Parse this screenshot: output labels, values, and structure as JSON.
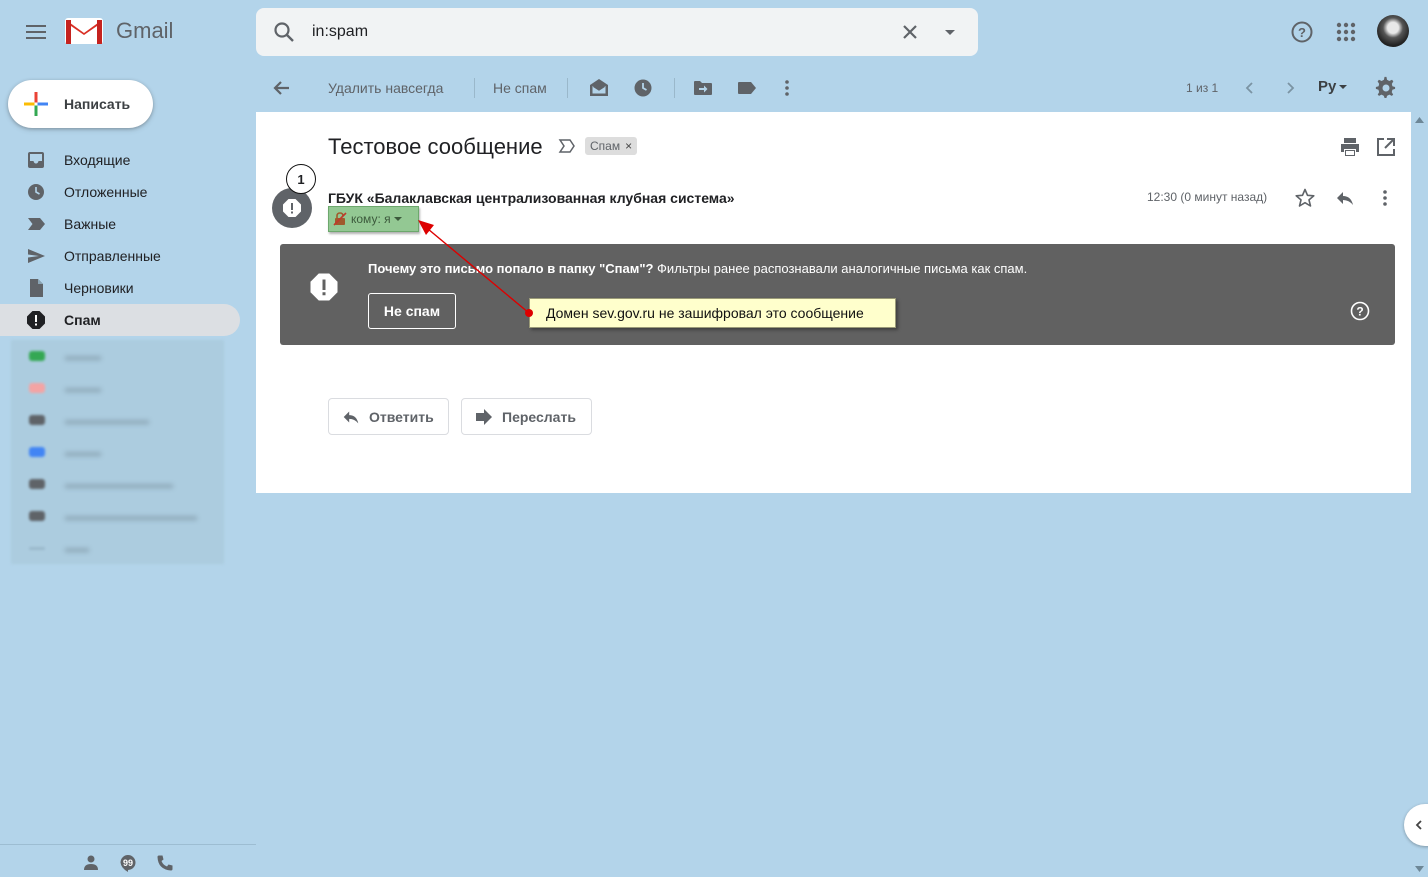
{
  "app": {
    "name": "Gmail"
  },
  "search": {
    "query": "in:spam"
  },
  "compose": {
    "label": "Написать"
  },
  "sidebar": {
    "items": [
      {
        "label": "Входящие",
        "icon": "inbox-icon"
      },
      {
        "label": "Отложенные",
        "icon": "clock-icon"
      },
      {
        "label": "Важные",
        "icon": "label-important-icon"
      },
      {
        "label": "Отправленные",
        "icon": "send-icon"
      },
      {
        "label": "Черновики",
        "icon": "draft-icon"
      },
      {
        "label": "Спам",
        "icon": "spam-icon",
        "active": true
      }
    ],
    "labels_blurred": [
      {
        "color": "#34a853"
      },
      {
        "color": "#f4a4a4"
      },
      {
        "color": "#5f6368"
      },
      {
        "color": "#4285f4"
      },
      {
        "color": "#5f6368"
      },
      {
        "color": "#5f6368"
      },
      {
        "color": "#9ab8cb"
      }
    ]
  },
  "toolbar": {
    "delete_forever": "Удалить навсегда",
    "not_spam": "Не спам",
    "pager": "1 из 1",
    "lang": "Ру"
  },
  "message": {
    "subject": "Тестовое сообщение",
    "spam_chip": "Спам",
    "sender": "ГБУК «Балаклавская централизованная клубная система»",
    "to": "кому: я",
    "time": "12:30 (0 минут назад)",
    "badge": "1",
    "warning_bold": "Почему это письмо попало в папку \"Спам\"?",
    "warning_text": " Фильтры ранее распознавали аналогичные письма как спам.",
    "warning_button": "Не спам",
    "tooltip": "Домен sev.gov.ru не зашифровал это сообщение",
    "reply": "Ответить",
    "forward": "Переслать"
  },
  "colors": {
    "background": "#b3d4ea",
    "warning_bg": "#616161",
    "to_chip": "#93c893",
    "tooltip_bg": "#ffffcc",
    "arrow": "#dd0000"
  }
}
